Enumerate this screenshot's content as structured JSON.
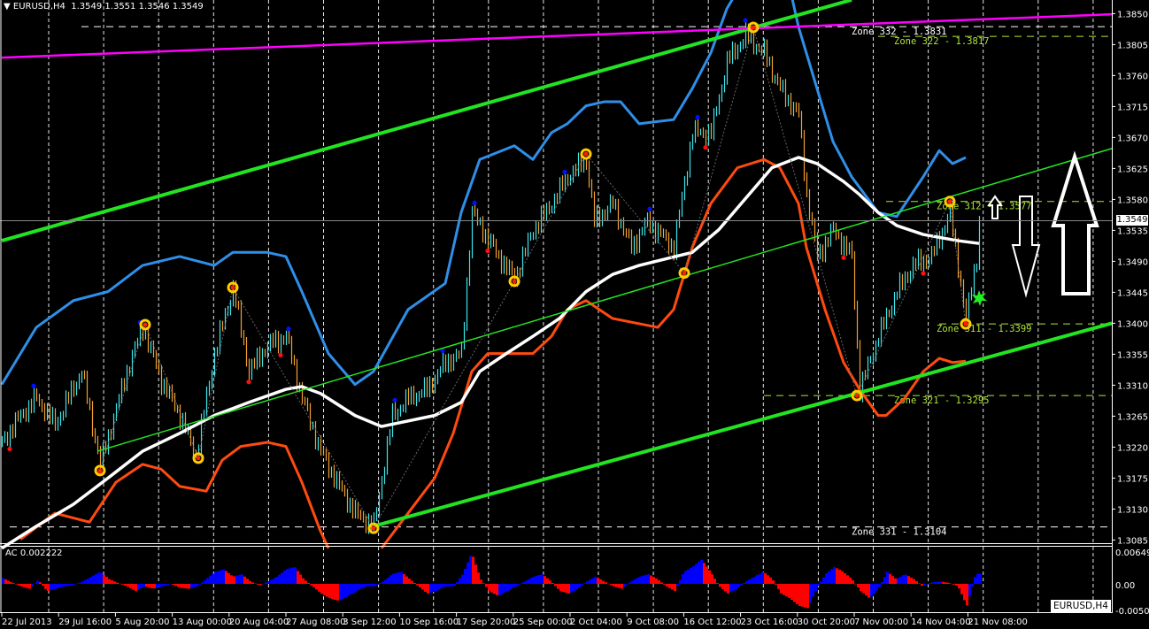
{
  "header": {
    "symbol": "EURUSD,H4",
    "ohlc": "1.3549 1.3551 1.3546 1.3549"
  },
  "current_price_label": "1.3549",
  "symbol_badge": "EURUSD,H4",
  "colors": {
    "bull": "#3fe3ea",
    "bear": "#f0a030",
    "upper_band": "#2f8fe8",
    "lower_band": "#ff4a10",
    "ma": "#ffffff",
    "channel": "#22e422",
    "magenta": "#ff00ff",
    "zone_green": "#aee83a",
    "ac_up": "#0000ff",
    "ac_down": "#ff0000"
  },
  "chart_data": {
    "type": "candlestick",
    "title": "EURUSD,H4",
    "y_ticks": [
      "1.3850",
      "1.3805",
      "1.3760",
      "1.3715",
      "1.3670",
      "1.3625",
      "1.3580",
      "1.3535",
      "1.3490",
      "1.3445",
      "1.3400",
      "1.3355",
      "1.3310",
      "1.3265",
      "1.3220",
      "1.3175",
      "1.3130",
      "1.3085"
    ],
    "ylim": [
      1.3085,
      1.385
    ],
    "x_ticks": [
      "22 Jul 2013",
      "29 Jul 16:00",
      "5 Aug 20:00",
      "13 Aug 00:00",
      "20 Aug 04:00",
      "27 Aug 08:00",
      "3 Sep 12:00",
      "10 Sep 16:00",
      "17 Sep 20:00",
      "25 Sep 00:00",
      "2 Oct 04:00",
      "9 Oct 08:00",
      "16 Oct 12:00",
      "23 Oct 16:00",
      "30 Oct 20:00",
      "7 Nov 00:00",
      "14 Nov 04:00",
      "21 Nov 08:00"
    ],
    "close_path": [
      [
        0,
        1.3227
      ],
      [
        7,
        1.3266
      ],
      [
        13,
        1.3291
      ],
      [
        20,
        1.3253
      ],
      [
        30,
        1.333
      ],
      [
        37,
        1.3195
      ],
      [
        47,
        1.333
      ],
      [
        53,
        1.3394
      ],
      [
        60,
        1.3317
      ],
      [
        67,
        1.3266
      ],
      [
        73,
        1.3208
      ],
      [
        80,
        1.3356
      ],
      [
        87,
        1.3452
      ],
      [
        93,
        1.333
      ],
      [
        100,
        1.3368
      ],
      [
        107,
        1.3381
      ],
      [
        113,
        1.3291
      ],
      [
        120,
        1.3214
      ],
      [
        127,
        1.3163
      ],
      [
        133,
        1.3124
      ],
      [
        140,
        1.3105
      ],
      [
        147,
        1.3266
      ],
      [
        153,
        1.3291
      ],
      [
        160,
        1.3304
      ],
      [
        167,
        1.3343
      ],
      [
        173,
        1.3356
      ],
      [
        177,
        1.3561
      ],
      [
        187,
        1.3497
      ],
      [
        193,
        1.3465
      ],
      [
        200,
        1.3536
      ],
      [
        207,
        1.3574
      ],
      [
        213,
        1.3613
      ],
      [
        220,
        1.3638
      ],
      [
        223,
        1.3548
      ],
      [
        230,
        1.3574
      ],
      [
        237,
        1.351
      ],
      [
        243,
        1.3548
      ],
      [
        253,
        1.351
      ],
      [
        260,
        1.3677
      ],
      [
        267,
        1.3677
      ],
      [
        273,
        1.378
      ],
      [
        280,
        1.3818
      ],
      [
        287,
        1.3793
      ],
      [
        293,
        1.3741
      ],
      [
        300,
        1.3703
      ],
      [
        303,
        1.3587
      ],
      [
        307,
        1.3497
      ],
      [
        313,
        1.3536
      ],
      [
        320,
        1.3497
      ],
      [
        323,
        1.3304
      ],
      [
        330,
        1.3381
      ],
      [
        337,
        1.3446
      ],
      [
        343,
        1.3484
      ],
      [
        350,
        1.3497
      ],
      [
        357,
        1.3561
      ],
      [
        360,
        1.3484
      ],
      [
        363,
        1.3407
      ],
      [
        367,
        1.3497
      ],
      [
        368,
        1.3549
      ]
    ],
    "upper_band": [
      [
        0,
        1.3311
      ],
      [
        13,
        1.3394
      ],
      [
        27,
        1.3433
      ],
      [
        40,
        1.3446
      ],
      [
        53,
        1.3484
      ],
      [
        67,
        1.3497
      ],
      [
        80,
        1.3484
      ],
      [
        87,
        1.3503
      ],
      [
        100,
        1.3503
      ],
      [
        107,
        1.3497
      ],
      [
        113,
        1.3446
      ],
      [
        123,
        1.3356
      ],
      [
        133,
        1.3311
      ],
      [
        140,
        1.333
      ],
      [
        153,
        1.342
      ],
      [
        167,
        1.3458
      ],
      [
        173,
        1.3561
      ],
      [
        180,
        1.3638
      ],
      [
        193,
        1.3658
      ],
      [
        200,
        1.3638
      ],
      [
        207,
        1.3677
      ],
      [
        213,
        1.369
      ],
      [
        220,
        1.3716
      ],
      [
        227,
        1.3722
      ],
      [
        233,
        1.3722
      ],
      [
        240,
        1.369
      ],
      [
        253,
        1.3696
      ],
      [
        260,
        1.3741
      ],
      [
        267,
        1.3793
      ],
      [
        273,
        1.3857
      ],
      [
        277,
        1.3883
      ],
      [
        297,
        1.3883
      ],
      [
        300,
        1.3831
      ],
      [
        307,
        1.3741
      ],
      [
        313,
        1.3664
      ],
      [
        320,
        1.3613
      ],
      [
        330,
        1.3561
      ],
      [
        337,
        1.3555
      ],
      [
        347,
        1.3613
      ],
      [
        353,
        1.3651
      ],
      [
        358,
        1.3632
      ],
      [
        363,
        1.3641
      ]
    ],
    "lower_band": [
      [
        7,
        1.3086
      ],
      [
        20,
        1.3124
      ],
      [
        33,
        1.3111
      ],
      [
        43,
        1.3169
      ],
      [
        53,
        1.3195
      ],
      [
        60,
        1.3188
      ],
      [
        67,
        1.3163
      ],
      [
        77,
        1.3156
      ],
      [
        83,
        1.3201
      ],
      [
        90,
        1.3221
      ],
      [
        100,
        1.3227
      ],
      [
        107,
        1.3221
      ],
      [
        113,
        1.3169
      ],
      [
        120,
        1.3098
      ],
      [
        123,
        1.3073
      ],
      [
        143,
        1.3073
      ],
      [
        153,
        1.3124
      ],
      [
        163,
        1.3175
      ],
      [
        170,
        1.324
      ],
      [
        177,
        1.333
      ],
      [
        183,
        1.3356
      ],
      [
        200,
        1.3356
      ],
      [
        207,
        1.3381
      ],
      [
        213,
        1.342
      ],
      [
        220,
        1.3433
      ],
      [
        230,
        1.3407
      ],
      [
        247,
        1.3394
      ],
      [
        253,
        1.342
      ],
      [
        260,
        1.351
      ],
      [
        267,
        1.3574
      ],
      [
        277,
        1.3626
      ],
      [
        287,
        1.3638
      ],
      [
        293,
        1.3626
      ],
      [
        300,
        1.3574
      ],
      [
        303,
        1.351
      ],
      [
        310,
        1.342
      ],
      [
        317,
        1.3343
      ],
      [
        323,
        1.3304
      ],
      [
        330,
        1.3266
      ],
      [
        333,
        1.3266
      ],
      [
        340,
        1.3291
      ],
      [
        347,
        1.333
      ],
      [
        353,
        1.3349
      ],
      [
        358,
        1.3343
      ],
      [
        363,
        1.3345
      ]
    ],
    "moving_average": [
      [
        0,
        1.3073
      ],
      [
        13,
        1.3105
      ],
      [
        27,
        1.3137
      ],
      [
        40,
        1.3175
      ],
      [
        53,
        1.3214
      ],
      [
        67,
        1.324
      ],
      [
        80,
        1.3266
      ],
      [
        93,
        1.3285
      ],
      [
        107,
        1.3304
      ],
      [
        113,
        1.3308
      ],
      [
        120,
        1.3298
      ],
      [
        133,
        1.3266
      ],
      [
        143,
        1.325
      ],
      [
        163,
        1.3266
      ],
      [
        173,
        1.3285
      ],
      [
        180,
        1.333
      ],
      [
        190,
        1.3356
      ],
      [
        200,
        1.3381
      ],
      [
        210,
        1.3407
      ],
      [
        220,
        1.3446
      ],
      [
        230,
        1.3471
      ],
      [
        240,
        1.3484
      ],
      [
        260,
        1.3503
      ],
      [
        270,
        1.3536
      ],
      [
        280,
        1.3581
      ],
      [
        290,
        1.3626
      ],
      [
        300,
        1.3641
      ],
      [
        307,
        1.3632
      ],
      [
        317,
        1.3606
      ],
      [
        323,
        1.3587
      ],
      [
        330,
        1.3561
      ],
      [
        337,
        1.3542
      ],
      [
        347,
        1.3529
      ],
      [
        360,
        1.352
      ],
      [
        368,
        1.3516
      ]
    ],
    "channels": [
      {
        "name": "upper-channel",
        "color": "#22e422",
        "width": "thick",
        "points": [
          [
            0,
            1.352
          ],
          [
            320,
            1.387
          ]
        ]
      },
      {
        "name": "lower-channel",
        "color": "#22e422",
        "width": "thick",
        "points": [
          [
            140,
            1.3105
          ],
          [
            418,
            1.34
          ]
        ]
      },
      {
        "name": "mid-channel",
        "color": "#22e422",
        "width": "thin",
        "points": [
          [
            36,
            1.3214
          ],
          [
            418,
            1.3654
          ]
        ]
      },
      {
        "name": "magenta-trendline",
        "color": "#ff00ff",
        "width": "medium",
        "points": [
          [
            0,
            1.3786
          ],
          [
            418,
            1.3849
          ]
        ]
      }
    ],
    "zigzag_pivots": [
      [
        37,
        1.3186
      ],
      [
        54,
        1.3398
      ],
      [
        74,
        1.3204
      ],
      [
        87,
        1.3452
      ],
      [
        140,
        1.3102
      ],
      [
        193,
        1.3461
      ],
      [
        220,
        1.3646
      ],
      [
        257,
        1.3473
      ],
      [
        283,
        1.383
      ],
      [
        322,
        1.3295
      ],
      [
        357,
        1.3577
      ],
      [
        363,
        1.3399
      ]
    ],
    "zones": [
      {
        "label": "Zone 332 - 1.3831",
        "price": 1.3831,
        "from": 30,
        "color": "#ffffff"
      },
      {
        "label": "Zone 322 - 1.3817",
        "price": 1.3817,
        "from": 330,
        "color": "#aee83a"
      },
      {
        "label": "Zone 312 - 1.3577",
        "price": 1.3577,
        "from": 333,
        "color": "#aee83a"
      },
      {
        "label": "Zone 311 - 1.3399",
        "price": 1.3399,
        "from": 353,
        "color": "#aee83a"
      },
      {
        "label": "Zone 321 - 1.3295",
        "price": 1.3295,
        "from": 287,
        "color": "#aee83a"
      },
      {
        "label": "Zone 331 - 1.3104",
        "price": 1.3104,
        "from": 3,
        "color": "#ffffff"
      }
    ],
    "current_price": 1.3549,
    "ac": {
      "label": "AC 0.002222",
      "y_ticks": [
        "0.006491",
        "0.00",
        "-0.00509"
      ],
      "ylim": [
        -0.00509,
        0.006491
      ],
      "unit": 0.001,
      "bars_per_value": 3.33,
      "values": [
        1.2,
        0.3,
        -0.5,
        -1.0,
        0.8,
        -1.5,
        -1.0,
        -0.5,
        -0.2,
        0.5,
        1.5,
        2.5,
        1.0,
        0.2,
        -0.5,
        -1.5,
        -0.5,
        -1.0,
        -0.5,
        0,
        -0.8,
        -1.0,
        -0.5,
        1.0,
        2.5,
        3.0,
        1.5,
        2.0,
        0.5,
        -0.3,
        0.5,
        1.5,
        3.0,
        3.5,
        1.0,
        -0.5,
        -2.0,
        -3.0,
        -3.5,
        -2.5,
        -1.5,
        -0.5,
        -0.5,
        0.5,
        2.0,
        2.5,
        1.0,
        -0.5,
        -2.0,
        -1.5,
        -0.5,
        -0.5,
        2.0,
        6.4,
        1.0,
        -1.5,
        -2.5,
        -1.5,
        -0.5,
        0.5,
        1.5,
        2.0,
        0.5,
        -1.5,
        -2.0,
        -1.0,
        0.5,
        1.5,
        0.5,
        -0.5,
        -1.0,
        0.5,
        1.5,
        2.0,
        1.0,
        -0.5,
        -1.5,
        2.5,
        3.5,
        5.0,
        2.5,
        -0.5,
        -2.0,
        -1.0,
        0.5,
        1.5,
        2.5,
        1.0,
        -2.0,
        -3.0,
        -4.5,
        -5.0,
        -1.0,
        2.0,
        3.5,
        2.5,
        1.0,
        -1.5,
        -3.0,
        -1.0,
        2.5,
        1.0,
        2.0,
        1.0,
        -0.5,
        0.3,
        0.5,
        0.2,
        -0.5,
        -4.5,
        2.0,
        2.3
      ]
    }
  }
}
